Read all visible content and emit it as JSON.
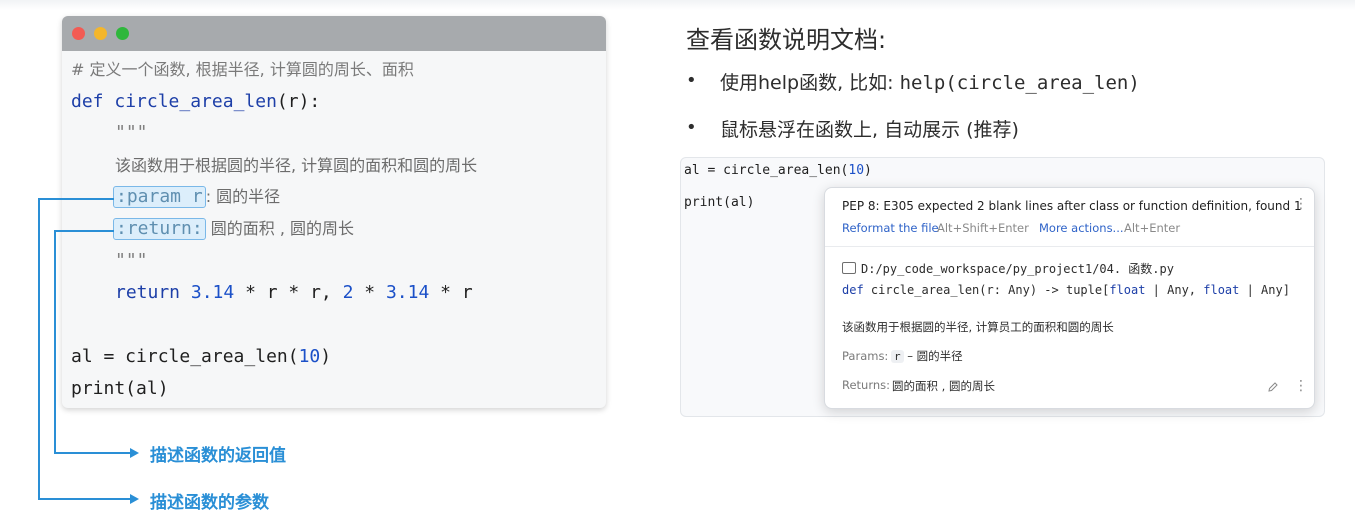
{
  "code_window": {
    "line_comment": "# 定义一个函数, 根据半径, 计算圆的周长、面积",
    "def_kw": "def",
    "func_name": "circle_area_len",
    "def_rest": "(r):",
    "doc_open": "\"\"\"",
    "doc_desc": "该函数用于根据圆的半径, 计算圆的面积和圆的周长",
    "param_tag": ":param r",
    "param_desc": ": 圆的半径",
    "return_tag": ":return:",
    "return_desc": " 圆的面积 , 圆的周长",
    "doc_close": "\"\"\"",
    "return_kw": "return",
    "return_n1": "3.14",
    "return_op1": " * r * r, ",
    "return_n2": "2",
    "return_op2": " * ",
    "return_n3": "3.14",
    "return_op3": " * r",
    "assign_left": "al = circle_area_len(",
    "assign_num": "10",
    "assign_right": ")",
    "print_line": "print(al)"
  },
  "callouts": {
    "return_label": "描述函数的返回值",
    "param_label": "描述函数的参数"
  },
  "right": {
    "heading": "查看函数说明文档:",
    "bullet1_prefix": "使用help函数, 比如: ",
    "bullet1_code": "help(circle_area_len)",
    "bullet2": "鼠标悬浮在函数上, 自动展示 (推荐)"
  },
  "ide": {
    "line1_left": "al = circle_area_len(",
    "line1_num": "10",
    "line1_right": ")",
    "line2": "print(al)"
  },
  "popup": {
    "warning": "PEP 8: E305 expected 2 blank lines after class or function definition, found 1",
    "reformat_label": "Reformat the file",
    "reformat_shortcut": "Alt+Shift+Enter",
    "more_actions_label": "More actions...",
    "more_actions_shortcut": "Alt+Enter",
    "path": "D:/py_code_workspace/py_project1/04. 函数.py",
    "sig_def": "def",
    "sig_name": " circle_area_len(r: Any) -> tuple[",
    "sig_float1": "float",
    "sig_mid": " | Any, ",
    "sig_float2": "float",
    "sig_end": " | Any]",
    "description": "该函数用于根据圆的半径, 计算员工的面积和圆的周长",
    "params_label": "Params:",
    "params_code": "r",
    "params_desc": " – 圆的半径",
    "returns_label": "Returns:",
    "returns_desc": "圆的面积 , 圆的周长",
    "kebab": "⋮"
  },
  "colors": {
    "accent": "#2a8fd6",
    "keyword": "#1d3fa8",
    "link": "#2f63c8"
  }
}
